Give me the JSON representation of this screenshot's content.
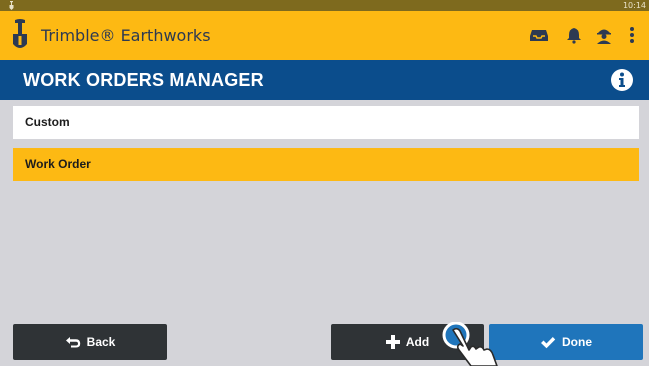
{
  "status_bar": {
    "time": "10:14"
  },
  "app_bar": {
    "title": "Trimble® Earthworks",
    "icons": [
      "shovel-logo-icon",
      "inbox-icon",
      "bell-icon",
      "operator-icon",
      "more-vert-icon"
    ],
    "background": "#fdb913"
  },
  "header": {
    "title": "WORK ORDERS MANAGER",
    "background": "#0b4d8c",
    "info_icon": "info-icon"
  },
  "list": {
    "items": [
      {
        "label": "Custom",
        "selected": false
      },
      {
        "label": "Work Order",
        "selected": true
      }
    ]
  },
  "buttons": {
    "back": "Back",
    "add": "Add",
    "done": "Done"
  },
  "colors": {
    "accent": "#fdb913",
    "header": "#0b4d8c",
    "done": "#1f75bb",
    "dark_button": "#2f3336",
    "content_bg": "#d4d4d9"
  }
}
